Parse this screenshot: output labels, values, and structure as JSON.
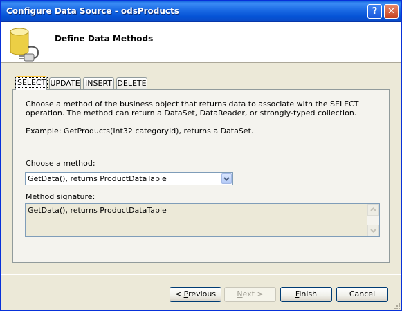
{
  "window": {
    "title": "Configure Data Source - odsProducts"
  },
  "titlebar": {
    "help_label": "?",
    "close_label": "✕"
  },
  "header": {
    "title": "Define Data Methods",
    "icon": "database-plug-icon"
  },
  "tabs": [
    {
      "label": "SELECT",
      "active": true
    },
    {
      "label": "UPDATE",
      "active": false
    },
    {
      "label": "INSERT",
      "active": false
    },
    {
      "label": "DELETE",
      "active": false
    }
  ],
  "panel": {
    "description": "Choose a method of the business object that returns data to associate with the SELECT operation. The method can return a DataSet, DataReader, or strongly-typed collection.",
    "example": "Example: GetProducts(Int32 categoryId), returns a DataSet.",
    "choose_label_accel": "C",
    "choose_label_rest": "hoose a method:",
    "method_selected": "GetData(), returns ProductDataTable",
    "signature_label_accel": "M",
    "signature_label_rest": "ethod signature:",
    "signature_value": "GetData(), returns ProductDataTable"
  },
  "buttons": {
    "previous_prefix": "< ",
    "previous_accel": "P",
    "previous_rest": "revious",
    "next_accel": "N",
    "next_rest": "ext >",
    "finish_accel": "F",
    "finish_rest": "inish",
    "cancel": "Cancel"
  },
  "colors": {
    "titlebar": "#0553d6",
    "dialog_bg": "#ece9d8",
    "active_tab_accent": "#ffc83c"
  }
}
